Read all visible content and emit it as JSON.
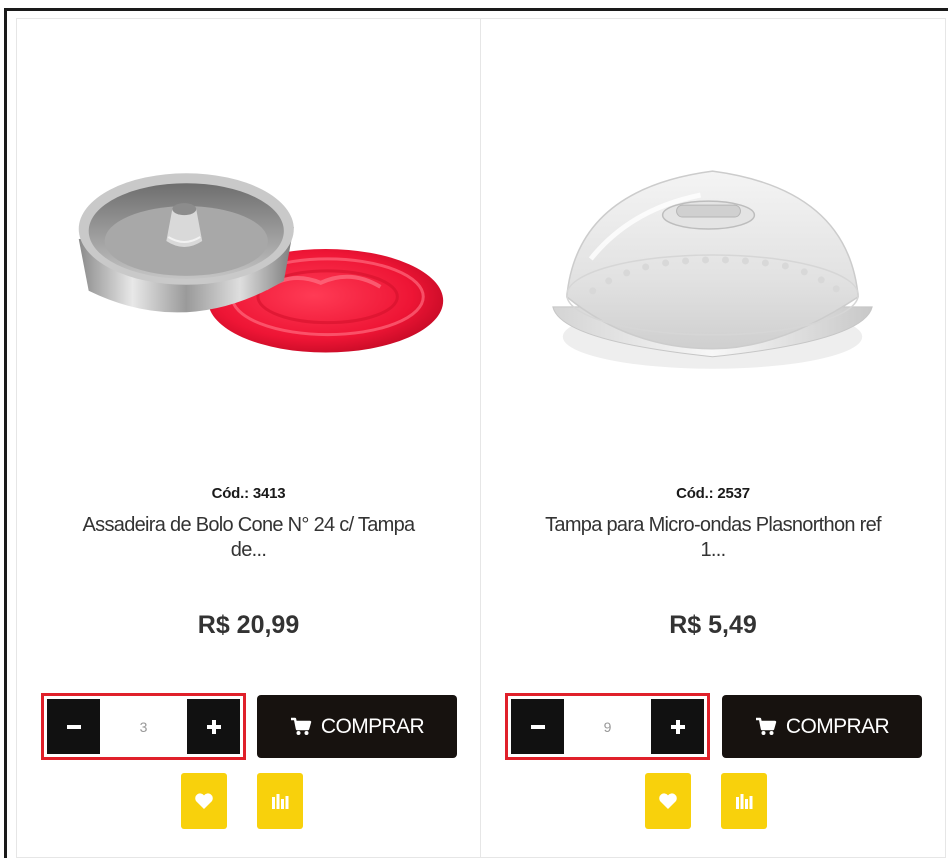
{
  "colors": {
    "accent_yellow": "#f8d10c",
    "button_dark": "#17120f",
    "highlight_red": "#e0202a"
  },
  "products": [
    {
      "code_label": "Cód.: 3413",
      "name": "Assadeira de Bolo Cone N° 24 c/ Tampa de...",
      "price": "R$ 20,99",
      "quantity": "3",
      "buy_label": "COMPRAR",
      "image": "cake-pan-with-red-lid",
      "icons": {
        "minus": "minus-icon",
        "plus": "plus-icon",
        "cart": "cart-icon",
        "favorite": "heart-icon",
        "compare": "compare-icon"
      }
    },
    {
      "code_label": "Cód.: 2537",
      "name": "Tampa para Micro-ondas Plasnorthon ref 1...",
      "price": "R$ 5,49",
      "quantity": "9",
      "buy_label": "COMPRAR",
      "image": "microwave-cover",
      "icons": {
        "minus": "minus-icon",
        "plus": "plus-icon",
        "cart": "cart-icon",
        "favorite": "heart-icon",
        "compare": "compare-icon"
      }
    }
  ]
}
